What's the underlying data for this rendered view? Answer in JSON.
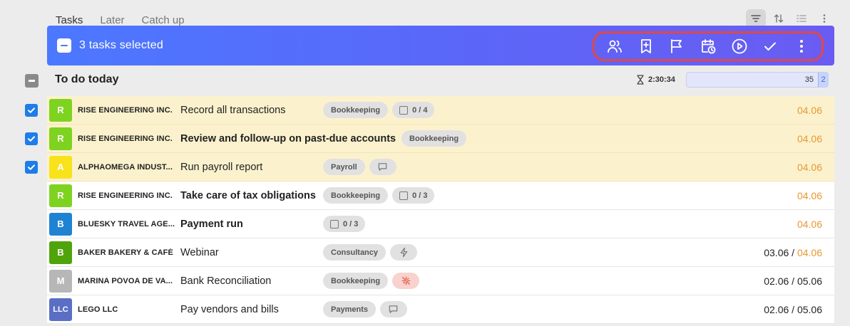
{
  "tabs": [
    {
      "label": "Tasks",
      "active": true
    },
    {
      "label": "Later",
      "active": false
    },
    {
      "label": "Catch up",
      "active": false
    }
  ],
  "view_tools": [
    "filter-icon",
    "sort-icon",
    "list-view-icon",
    "more-vertical-icon"
  ],
  "selection_bar": {
    "text": "3 tasks selected",
    "actions": [
      "assign-users-icon",
      "bookmark-add-icon",
      "flag-icon",
      "schedule-icon",
      "start-icon",
      "complete-icon",
      "more-vertical-icon"
    ]
  },
  "section": {
    "title": "To do today",
    "timer": "2:30:34",
    "progress_count": "35",
    "progress_extra": "2"
  },
  "colors": {
    "accent": "#4c78ff",
    "highlight": "#e04848",
    "selected_row": "#fbf2cd",
    "date_orange": "#e8972f"
  },
  "tasks": [
    {
      "selected": true,
      "avatar": "R",
      "avatar_color": "#7ed321",
      "client": "RISE ENGINEERING INC.",
      "title": "Record all transactions",
      "bold": false,
      "tag": "Bookkeeping",
      "checklist": "0 / 4",
      "extra_icon": null,
      "start_date": null,
      "due_date": "04.06"
    },
    {
      "selected": true,
      "avatar": "R",
      "avatar_color": "#7ed321",
      "client": "RISE ENGINEERING INC.",
      "title": "Review and follow-up on past-due accounts",
      "bold": true,
      "tag": "Bookkeeping",
      "checklist": null,
      "extra_icon": null,
      "start_date": null,
      "due_date": "04.06"
    },
    {
      "selected": true,
      "avatar": "A",
      "avatar_color": "#f8e21c",
      "client": "ALPHAOMEGA INDUST...",
      "title": "Run payroll report",
      "bold": false,
      "tag": "Payroll",
      "checklist": null,
      "extra_icon": "comment-icon",
      "start_date": null,
      "due_date": "04.06"
    },
    {
      "selected": false,
      "avatar": "R",
      "avatar_color": "#7ed321",
      "client": "RISE ENGINEERING INC.",
      "title": "Take care of tax obligations",
      "bold": true,
      "tag": "Bookkeeping",
      "checklist": "0 / 3",
      "extra_icon": null,
      "start_date": null,
      "due_date": "04.06"
    },
    {
      "selected": false,
      "avatar": "B",
      "avatar_color": "#1f83d3",
      "client": "BLUESKY TRAVEL AGE...",
      "title": "Payment run",
      "bold": true,
      "tag": null,
      "checklist": "0 / 3",
      "extra_icon": null,
      "start_date": null,
      "due_date": "04.06"
    },
    {
      "selected": false,
      "avatar": "B",
      "avatar_color": "#4fa40b",
      "client": "BAKER BAKERY & CAFÉ",
      "title": "Webinar",
      "bold": false,
      "tag": "Consultancy",
      "checklist": null,
      "extra_icon": "lightning-icon",
      "start_date": "03.06",
      "due_date": "04.06"
    },
    {
      "selected": false,
      "avatar": "M",
      "avatar_color": "#b7b7b7",
      "client": "MARINA PÓVOA DE VA...",
      "title": "Bank Reconciliation",
      "bold": false,
      "tag": "Bookkeeping",
      "checklist": null,
      "extra_icon": "sync-off-icon",
      "start_date": "02.06",
      "due_date": "05.06"
    },
    {
      "selected": false,
      "avatar": "LLC",
      "avatar_color": "#5a6fc4",
      "client": "LEGO LLC",
      "title": "Pay vendors and bills",
      "bold": false,
      "tag": "Payments",
      "checklist": null,
      "extra_icon": "comment-icon",
      "start_date": "02.06",
      "due_date": "05.06"
    }
  ]
}
